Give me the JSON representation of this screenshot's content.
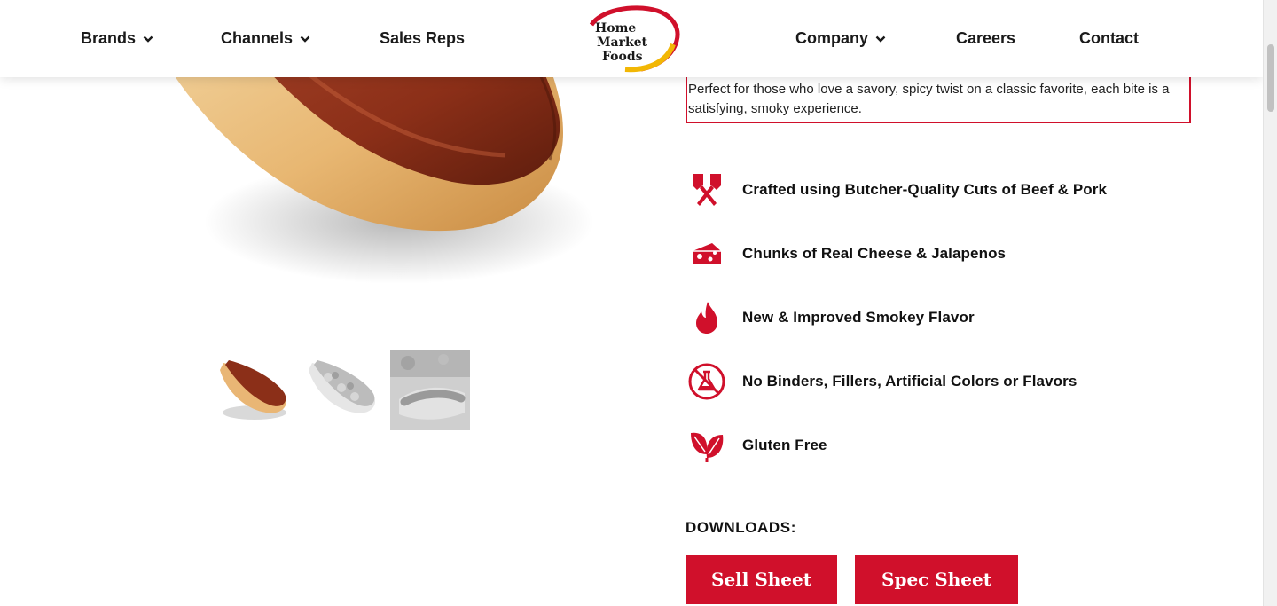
{
  "nav": {
    "brands": "Brands",
    "channels": "Channels",
    "sales_reps": "Sales Reps",
    "company": "Company",
    "careers": "Careers",
    "contact": "Contact"
  },
  "logo": {
    "line1": "Home",
    "line2": "Market",
    "line3": "Foods"
  },
  "product": {
    "description": "Perfect for those who love a savory, spicy twist on a classic favorite, each bite is a satisfying, smoky experience.",
    "thumbnails": [
      {
        "alt": "hot dog in bun"
      },
      {
        "alt": "hot dog with toppings"
      },
      {
        "alt": "hot dog lifestyle"
      }
    ]
  },
  "features": [
    {
      "icon": "cleaver-icon",
      "label": "Crafted using Butcher-Quality Cuts of Beef & Pork"
    },
    {
      "icon": "cheese-icon",
      "label": "Chunks of Real Cheese & Jalapenos"
    },
    {
      "icon": "flame-icon",
      "label": "New & Improved Smokey Flavor"
    },
    {
      "icon": "no-additives-icon",
      "label": "No Binders, Fillers, Artificial Colors or Flavors"
    },
    {
      "icon": "leaf-icon",
      "label": "Gluten Free"
    }
  ],
  "downloads": {
    "title": "DOWNLOADS:",
    "sell_sheet": "Sell Sheet",
    "spec_sheet": "Spec Sheet"
  },
  "colors": {
    "accent": "#d0102b",
    "logo_yellow": "#f2b705"
  }
}
